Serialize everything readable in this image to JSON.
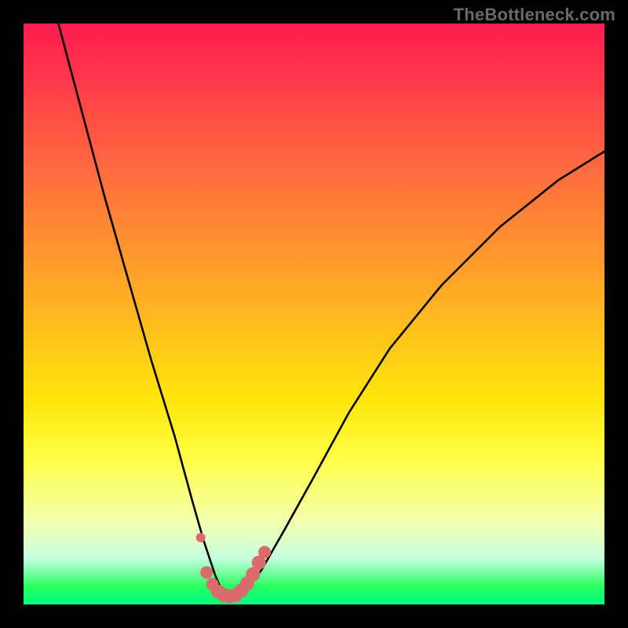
{
  "watermark": "TheBottleneck.com",
  "chart_data": {
    "type": "line",
    "title": "",
    "xlabel": "",
    "ylabel": "",
    "xlim": [
      0,
      100
    ],
    "ylim": [
      0,
      100
    ],
    "grid": false,
    "series": [
      {
        "name": "bottleneck-curve",
        "x": [
          6,
          10,
          14,
          18,
          22,
          26,
          29,
          31,
          33,
          34.5,
          36,
          38,
          41,
          45,
          50,
          56,
          63,
          72,
          82,
          92,
          100
        ],
        "values": [
          100,
          85,
          70,
          56,
          42,
          29,
          18,
          11,
          5,
          1.5,
          1,
          2,
          6,
          13,
          22,
          33,
          44,
          55,
          65,
          73,
          78
        ]
      }
    ],
    "markers": {
      "name": "highlight-band",
      "color": "#d96b6b",
      "points": [
        {
          "x": 30.5,
          "y": 11.5,
          "r": 6
        },
        {
          "x": 31.5,
          "y": 5.5,
          "r": 8
        },
        {
          "x": 32.5,
          "y": 3.5,
          "r": 8
        },
        {
          "x": 33.5,
          "y": 2.2,
          "r": 9
        },
        {
          "x": 34.5,
          "y": 1.6,
          "r": 9
        },
        {
          "x": 35.5,
          "y": 1.4,
          "r": 9
        },
        {
          "x": 36.5,
          "y": 1.6,
          "r": 9
        },
        {
          "x": 37.5,
          "y": 2.4,
          "r": 9
        },
        {
          "x": 38.5,
          "y": 3.6,
          "r": 9
        },
        {
          "x": 39.5,
          "y": 5.2,
          "r": 9
        },
        {
          "x": 40.5,
          "y": 7.2,
          "r": 9
        },
        {
          "x": 41.5,
          "y": 9.0,
          "r": 8
        }
      ]
    }
  }
}
